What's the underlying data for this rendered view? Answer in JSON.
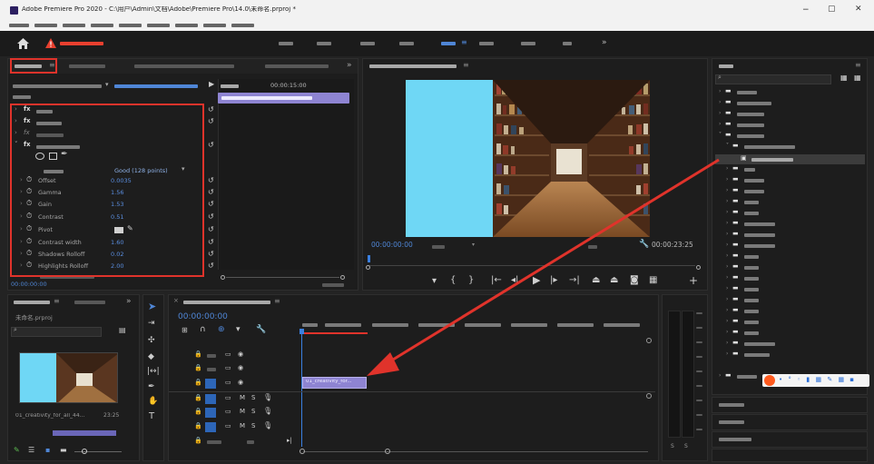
{
  "title": "Adobe Premiere Pro 2020 - C:\\用户\\Admin\\文档\\Adobe\\Premiere Pro\\14.0\\未命名.prproj *",
  "window_controls": {
    "minimize": "−",
    "maximize": "▢",
    "close": "✕"
  },
  "project": {
    "name": "未命名.prproj",
    "tab": "未命名"
  },
  "program": {
    "timecode_left": "00:00:00:00",
    "timecode_right": "00:00:23:25"
  },
  "effect_controls": {
    "keyframe_time": "00:00:15:00",
    "quality_value": "Good (128 points)",
    "bottom_time": "00:00:00:00"
  },
  "timeline": {
    "timecode": "00:00:00:00",
    "clip_label": "01_creativity_for..."
  },
  "media": {
    "thumbnail_caption": "01_creativity_for_all_44...",
    "duration": "23:25"
  },
  "effect_params": [
    {
      "name": "Offset",
      "value": "0.0035"
    },
    {
      "name": "Gamma",
      "value": "1.56"
    },
    {
      "name": "Gain",
      "value": "1.53"
    },
    {
      "name": "Contrast",
      "value": "0.51"
    },
    {
      "name": "Pivot",
      "value": ""
    },
    {
      "name": "Contrast width",
      "value": "1.60"
    },
    {
      "name": "Shadows Rolloff",
      "value": "0.02"
    },
    {
      "name": "Highlights Rolloff",
      "value": "2.00"
    }
  ],
  "colors": {
    "accent_blue": "#4f86d6",
    "clip_purple": "#8e84d2",
    "highlight_red": "#e0332b",
    "playhead": "#3a7fe0",
    "panel_bg": "#1d1d1d"
  },
  "icons": [
    "home-icon",
    "warning-icon",
    "search-icon",
    "play-icon",
    "step-back-icon",
    "step-forward-icon",
    "settings-wrench-icon",
    "folder-icon",
    "eye-icon",
    "lock-icon",
    "mic-icon",
    "arrow-icon"
  ]
}
